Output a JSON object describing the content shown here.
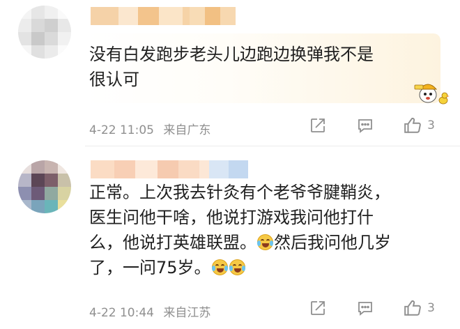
{
  "comments": [
    {
      "content_lines": [
        "没有白发跑步老头儿边跑边换弹我不是",
        "很认可"
      ],
      "time": "4-22 11:05",
      "location": "来自广东",
      "likes": "3"
    },
    {
      "content_lines": [
        "正常。上次我去针灸有个老爷爷腱鞘炎，",
        "医生问他干啥，他说打游戏我问他打什",
        "么，他说打英雄联盟。",
        "然后我问他几岁",
        "了，一问75岁。"
      ],
      "time": "4-22 10:44",
      "location": "来自江苏",
      "likes": "3"
    }
  ],
  "icons": {
    "share": "share-icon",
    "comment": "comment-icon",
    "like": "thumbs-up-icon",
    "emoji": "laughing-tears-emoji"
  },
  "colors": {
    "meta_text": "#8f8f8f",
    "comment_bg": "#fdf7ea",
    "name_blur": "#f3c48c"
  }
}
